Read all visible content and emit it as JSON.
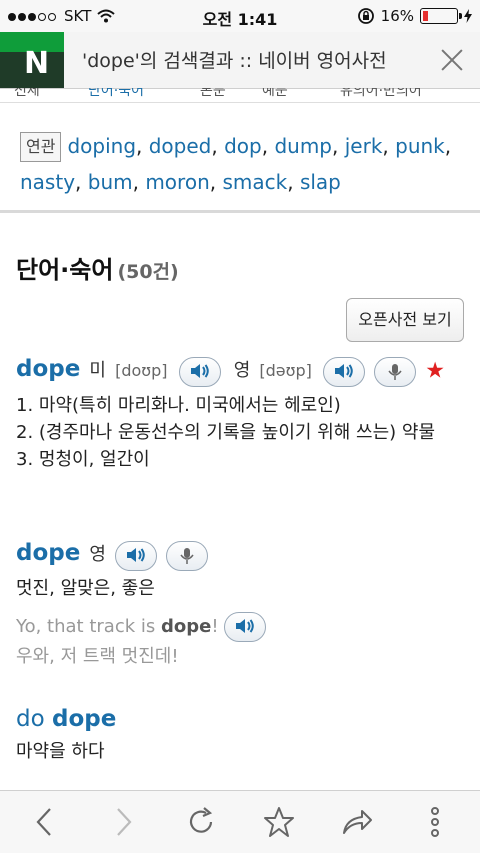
{
  "status": {
    "carrier": "SKT",
    "time": "오전 1:41",
    "battery": "16%",
    "battery_level": 0.16
  },
  "tab": {
    "title": "'dope'의 검색결과 :: 네이버 영어사전",
    "logo": "N"
  },
  "subtabs": [
    "전체",
    "단어·숙어",
    "본문",
    "예문",
    "유의어·반의어"
  ],
  "related": {
    "tag": "연관",
    "words": [
      "doping",
      "doped",
      "dop",
      "dump",
      "jerk",
      "punk",
      "nasty",
      "bum",
      "moron",
      "smack",
      "slap"
    ]
  },
  "section": {
    "title": "단어·숙어",
    "count": "(50건)",
    "open_dict": "오픈사전 보기"
  },
  "entry1": {
    "word": "dope",
    "us_label": "미",
    "us_pron": "[doʊp]",
    "uk_label": "영",
    "uk_pron": "[dəʊp]",
    "star": "★",
    "defs": [
      "1. 마약(특히 마리화나. 미국에서는 헤로인)",
      "2. (경주마나 운동선수의 기록을 높이기 위해 쓰는) 약물",
      "3. 멍청이, 얼간이"
    ]
  },
  "entry2": {
    "word": "dope",
    "lang": "영",
    "def": "멋진, 알맞은, 좋은",
    "ex_pre": "Yo, that track is ",
    "ex_bold": "dope",
    "ex_post": "!",
    "ex_tr": "우와, 저 트랙 멋진데!"
  },
  "entry3": {
    "pre": "do ",
    "bold": "dope",
    "def": "마약을 하다"
  },
  "colors": {
    "accent": "#1b6ea8",
    "star": "#e02020"
  }
}
